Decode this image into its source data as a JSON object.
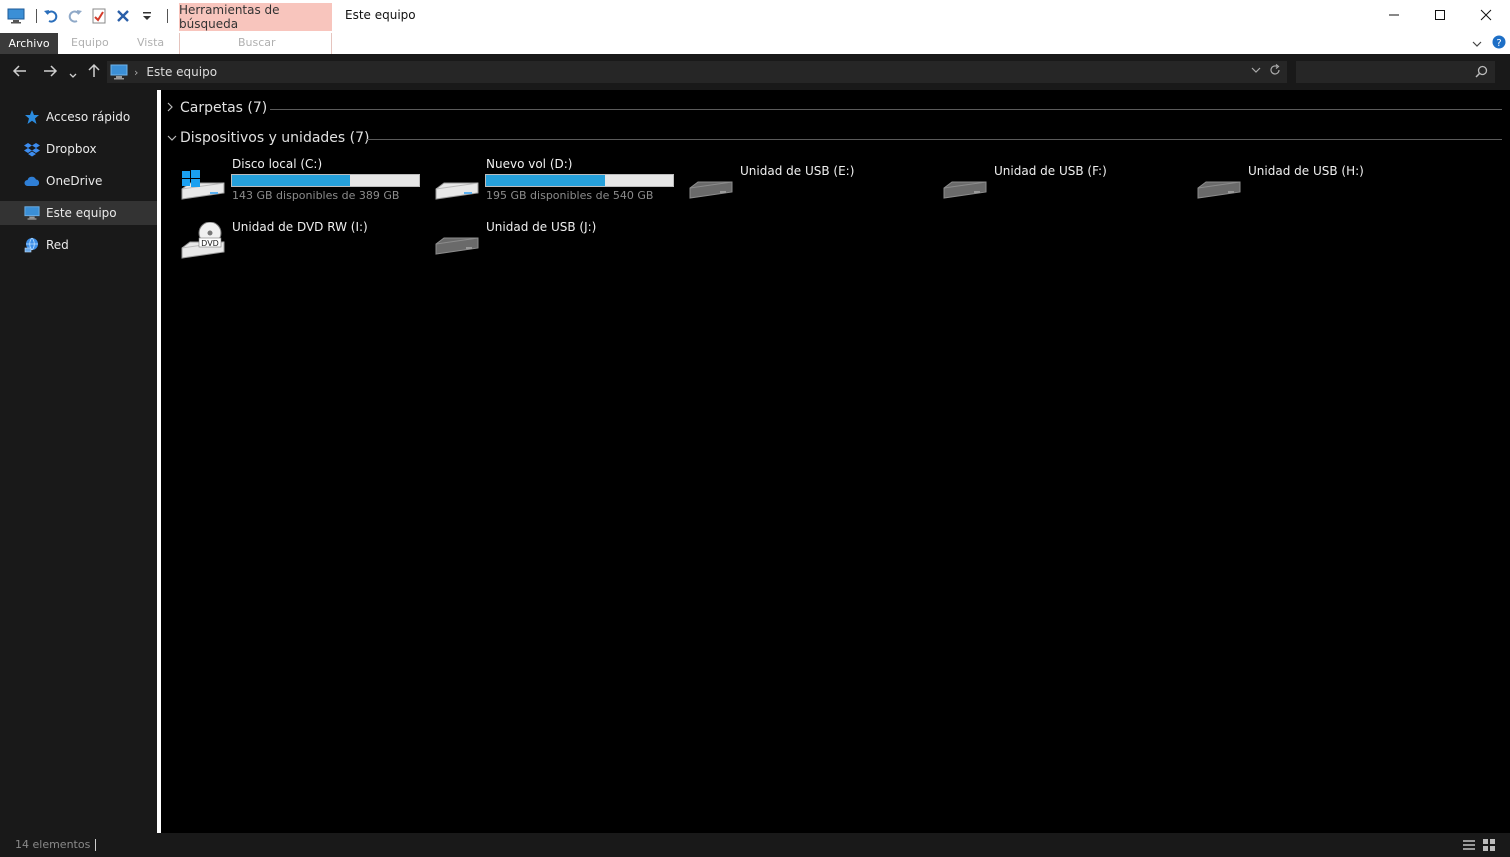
{
  "window": {
    "title": "Este equipo",
    "context_tab": "Herramientas de búsqueda",
    "controls": [
      "minimize",
      "maximize",
      "close"
    ]
  },
  "qat": {
    "icons": [
      "computer-icon",
      "undo-icon",
      "redo-icon",
      "properties-icon",
      "delete-icon",
      "customize-dropdown-icon"
    ]
  },
  "ribbon": {
    "tabs": {
      "archivo": "Archivo",
      "equipo": "Equipo",
      "vista": "Vista",
      "buscar": "Buscar"
    }
  },
  "address": {
    "crumb": "Este equipo",
    "search_placeholder": ""
  },
  "sidebar": {
    "items": [
      {
        "label": "Acceso rápido",
        "icon": "star-icon"
      },
      {
        "label": "Dropbox",
        "icon": "dropbox-icon"
      },
      {
        "label": "OneDrive",
        "icon": "cloud-icon"
      },
      {
        "label": "Este equipo",
        "icon": "computer-icon",
        "selected": true
      },
      {
        "label": "Red",
        "icon": "network-icon"
      }
    ]
  },
  "groups": {
    "carpetas": "Carpetas (7)",
    "dispositivos": "Dispositivos y unidades (7)"
  },
  "drives": [
    {
      "name": "Disco local (C:)",
      "free": "143 GB disponibles de 389 GB",
      "used_fraction": 0.632,
      "icon": "windows-drive-icon"
    },
    {
      "name": "Nuevo vol (D:)",
      "free": "195 GB disponibles de 540 GB",
      "used_fraction": 0.639,
      "icon": "hard-drive-icon"
    },
    {
      "name": "Unidad de USB (E:)",
      "icon": "usb-drive-icon"
    },
    {
      "name": "Unidad de USB (F:)",
      "icon": "usb-drive-icon"
    },
    {
      "name": "Unidad de USB (H:)",
      "icon": "usb-drive-icon"
    },
    {
      "name": "Unidad de DVD RW (I:)",
      "icon": "dvd-drive-icon",
      "icon_text": "DVD"
    },
    {
      "name": "Unidad de USB (J:)",
      "icon": "usb-drive-icon"
    }
  ],
  "status": {
    "items": "14 elementos"
  },
  "colors": {
    "accent_bar": "#26a0da",
    "context_tab": "#f8c5bd",
    "panel_bg": "#191919"
  }
}
